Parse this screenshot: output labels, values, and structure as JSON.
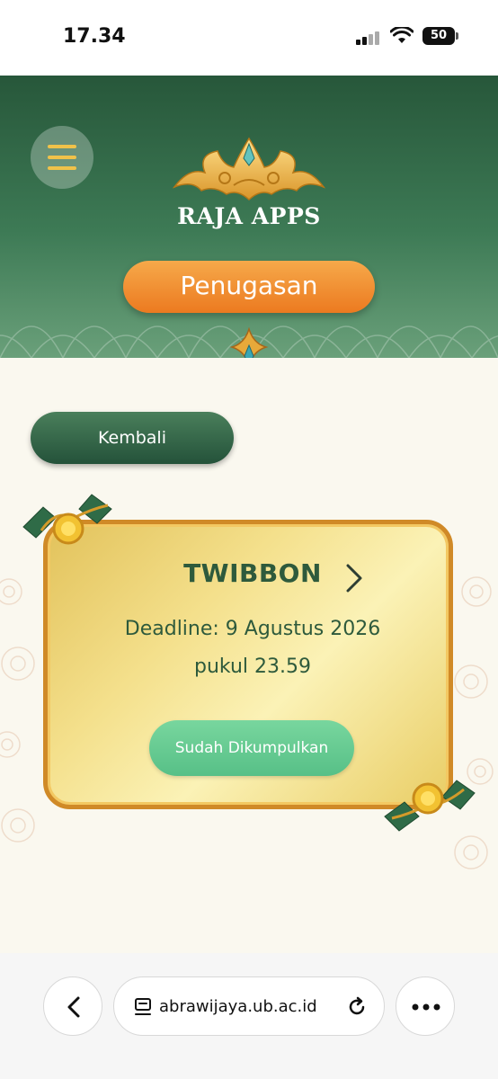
{
  "status_bar": {
    "time": "17.34",
    "battery": "50"
  },
  "header": {
    "brand": "RAJA APPS",
    "page_title": "Penugasan"
  },
  "back_button": {
    "label": "Kembali"
  },
  "task_card": {
    "title": "TWIBBON",
    "deadline": "Deadline: 9 Agustus 2026 pukul 23.59",
    "status": "Sudah Dikumpulkan"
  },
  "browser": {
    "url": "abrawijaya.ub.ac.id"
  },
  "colors": {
    "header_green": "#27573a",
    "accent_orange": "#ec7a20",
    "button_green": "#24523a",
    "status_green": "#57c087",
    "card_gold": "#f4e08c",
    "card_border": "#d08a27"
  },
  "icons": [
    "menu-icon",
    "crown-logo",
    "chevron-right-icon",
    "back-icon",
    "tabs-icon",
    "reload-icon",
    "more-icon"
  ]
}
